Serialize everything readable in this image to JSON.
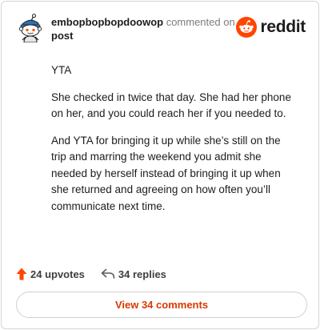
{
  "comment": {
    "username": "embopbopbopdoowop",
    "action_text": " commented on",
    "target": "post"
  },
  "logo": {
    "wordmark": "reddit",
    "icon": "reddit-snoo-icon",
    "brand_color": "#FF4500"
  },
  "body": {
    "paragraphs": [
      "YTA",
      "She checked in twice that day. She had her phone on her, and you could reach her if you needed to.",
      "And YTA for bringing it up while she’s still on the trip and marring the weekend you admit she needed by herself instead of bringing it up when she returned and agreeing on how often you’ll communicate next time."
    ]
  },
  "footer": {
    "upvotes": "24 upvotes",
    "upvote_icon": "upvote-arrow-icon",
    "upvote_color": "#FF4500",
    "replies": "34 replies",
    "reply_icon": "reply-arrow-icon"
  },
  "button": {
    "label": "View 34 comments",
    "color": "#D93A00"
  },
  "avatar": {
    "icon": "snoo-avatar-icon"
  }
}
